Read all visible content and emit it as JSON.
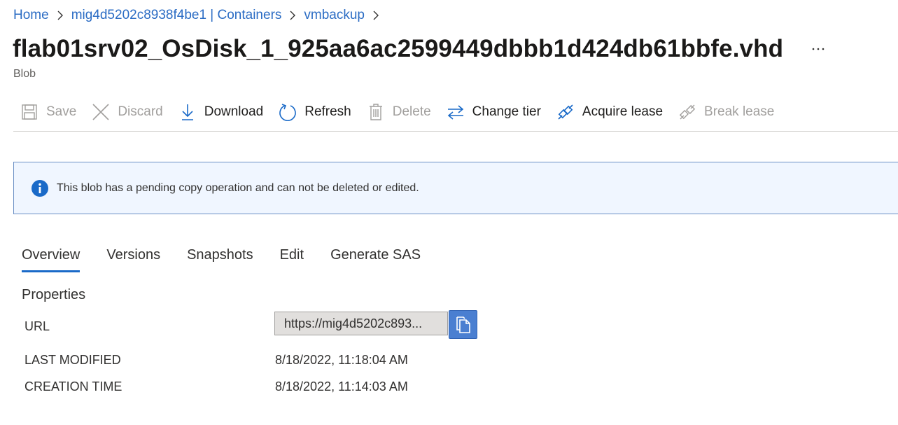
{
  "breadcrumb": [
    {
      "label": "Home"
    },
    {
      "label": "mig4d5202c8938f4be1 | Containers"
    },
    {
      "label": "vmbackup"
    }
  ],
  "title": "flab01srv02_OsDisk_1_925aa6ac2599449dbbb1d424db61bbfe.vhd",
  "subtitle": "Blob",
  "more_label": "···",
  "toolbar": {
    "save": "Save",
    "discard": "Discard",
    "download": "Download",
    "refresh": "Refresh",
    "delete": "Delete",
    "change_tier": "Change tier",
    "acquire_lease": "Acquire lease",
    "break_lease": "Break lease"
  },
  "banner": {
    "text": "This blob has a pending copy operation and can not be deleted or edited."
  },
  "tabs": [
    {
      "label": "Overview",
      "active": true
    },
    {
      "label": "Versions"
    },
    {
      "label": "Snapshots"
    },
    {
      "label": "Edit"
    },
    {
      "label": "Generate SAS"
    }
  ],
  "properties": {
    "section_title": "Properties",
    "url_label": "URL",
    "url_value": "https://mig4d5202c893...",
    "last_modified_label": "LAST MODIFIED",
    "last_modified_value": "8/18/2022, 11:18:04 AM",
    "creation_time_label": "CREATION TIME",
    "creation_time_value": "8/18/2022, 11:14:03 AM"
  },
  "colors": {
    "link": "#2b6cc4",
    "accent": "#1a6ac8",
    "banner_bg": "#f0f6ff",
    "disabled": "#a19f9d"
  }
}
